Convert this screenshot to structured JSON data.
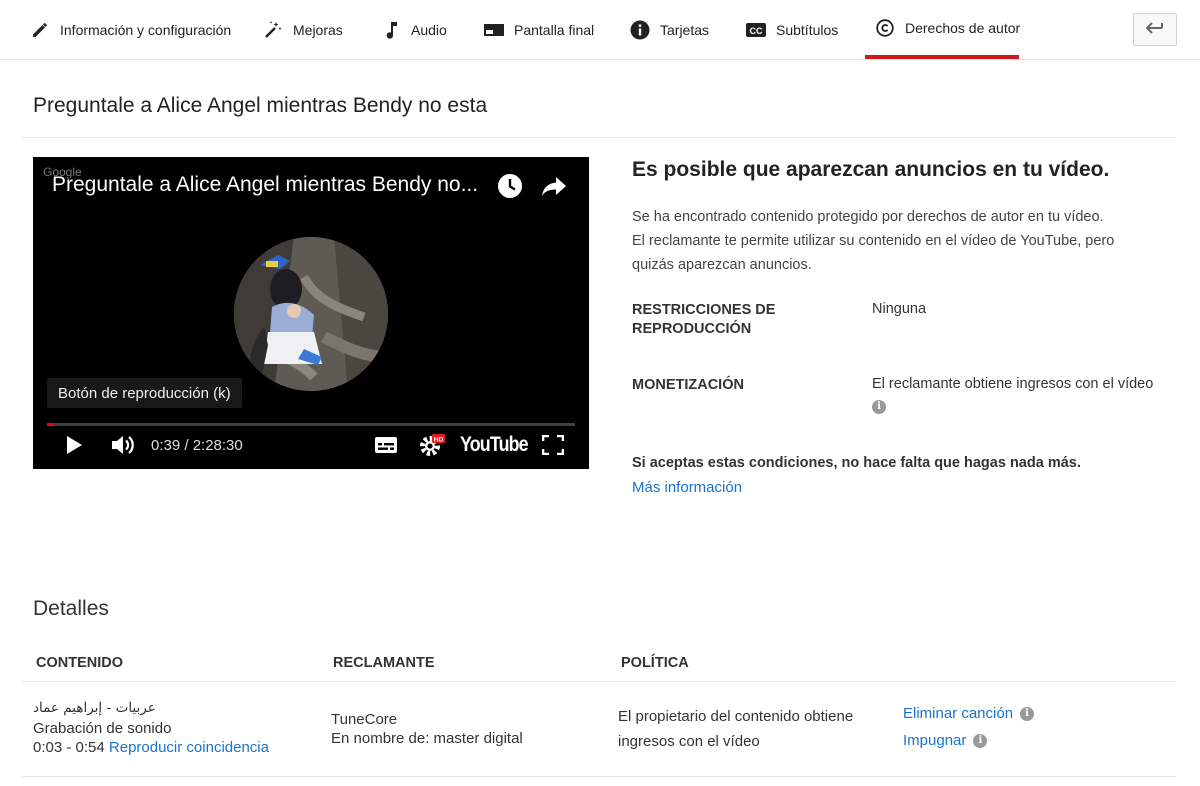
{
  "tabs": [
    {
      "label": "Información y configuración",
      "icon": "pencil-icon"
    },
    {
      "label": "Mejoras",
      "icon": "magic-wand-icon"
    },
    {
      "label": "Audio",
      "icon": "music-note-icon"
    },
    {
      "label": "Pantalla final",
      "icon": "end-screen-icon"
    },
    {
      "label": "Tarjetas",
      "icon": "info-icon"
    },
    {
      "label": "Subtítulos",
      "icon": "cc-icon"
    },
    {
      "label": "Derechos de autor",
      "icon": "copyright-icon",
      "active": true
    }
  ],
  "page_title": "Preguntale a Alice Angel mientras Bendy no esta",
  "player": {
    "brand": "Google",
    "title": "Preguntale a Alice Angel mientras Bendy no...",
    "tooltip": "Botón de reproducción (k)",
    "time": "0:39 / 2:28:30",
    "progress": 0.005,
    "logo": "YouTube"
  },
  "claim": {
    "heading": "Es posible que aparezcan anuncios en tu vídeo.",
    "description": [
      "Se ha encontrado contenido protegido por derechos de autor en tu vídeo.",
      "El reclamante te permite utilizar su contenido en el vídeo de YouTube, pero",
      "quizás aparezcan anuncios."
    ],
    "restrictions_label_1": "RESTRICCIONES DE",
    "restrictions_label_2": "REPRODUCCIÓN",
    "restrictions_value": "Ninguna",
    "monetization_label": "MONETIZACIÓN",
    "monetization_value": "El reclamante obtiene ingresos con el vídeo",
    "accept_note": "Si aceptas estas condiciones, no hace falta que hagas nada más.",
    "more_info": "Más información"
  },
  "details": {
    "title": "Detalles",
    "headers": {
      "content": "CONTENIDO",
      "claimant": "RECLAMANTE",
      "policy": "POLÍTICA"
    },
    "row": {
      "content_title": "عربيات - إبراهيم عماد",
      "content_type": "Grabación de sonido",
      "content_range": "0:03 - 0:54",
      "play_match": "Reproducir coincidencia",
      "claimant_name": "TuneCore",
      "claimant_behalf": "En nombre de: master digital",
      "policy_line1": "El propietario del contenido obtiene",
      "policy_line2": "ingresos con el vídeo",
      "remove_song": "Eliminar canción",
      "dispute": "Impugnar"
    }
  },
  "colors": {
    "accent_red": "#cc181e",
    "link_blue": "#1a73c8"
  }
}
